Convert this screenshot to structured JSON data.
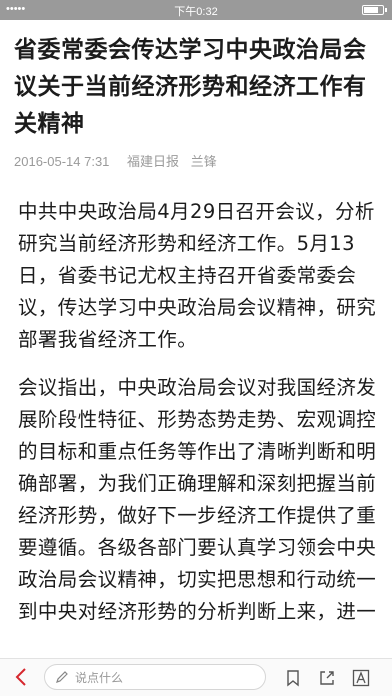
{
  "status_bar": {
    "carrier": "••••• ",
    "time": "下午0:32",
    "signal": "⬆"
  },
  "article": {
    "title": "省委常委会传达学习中央政治局会议关于当前经济形势和经济工作有关精神",
    "datetime": "2016-05-14 7:31",
    "source": "福建日报",
    "author": "兰锋",
    "paragraphs": [
      "中共中央政治局4月29日召开会议，分析研究当前经济形势和经济工作。5月13日，省委书记尤权主持召开省委常委会议，传达学习中央政治局会议精神，研究部署我省经济工作。",
      "会议指出，中央政治局会议对我国经济发展阶段性特征、形势态势走势、宏观调控的目标和重点任务等作出了清晰判断和明确部署，为我们正确理解和深刻把握当前经济形势，做好下一步经济工作提供了重要遵循。各级各部门要认真学习领会中央政治局会议精神，切实把思想和行动统一到中央对经济形势的分析判断上来，进一"
    ]
  },
  "toolbar": {
    "comment_placeholder": "说点什么",
    "icons": [
      "back-icon",
      "pencil-icon",
      "collect-icon",
      "share-icon",
      "font-size-icon"
    ],
    "accent_color": "#d6272e"
  }
}
